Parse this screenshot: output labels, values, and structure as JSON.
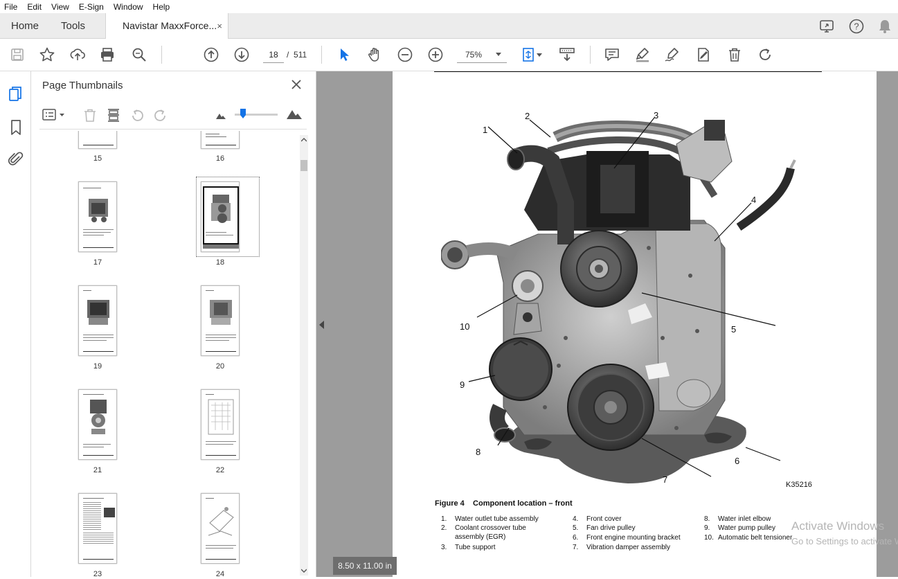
{
  "menu": [
    "File",
    "Edit",
    "View",
    "E-Sign",
    "Window",
    "Help"
  ],
  "tabs": {
    "home": "Home",
    "tools": "Tools",
    "document": "Navistar MaxxForce...",
    "close": "×"
  },
  "toolbar": {
    "current_page": "18",
    "page_sep": "/",
    "total_pages": "511",
    "zoom": "75%"
  },
  "thumbnails": {
    "title": "Page Thumbnails",
    "selected_page": "18",
    "pages": [
      "15",
      "16",
      "17",
      "18",
      "19",
      "20",
      "21",
      "22",
      "23",
      "24"
    ]
  },
  "document": {
    "page_size": "8.50 x 11.00 in",
    "figure_id": "K35216",
    "figure_number": "Figure 4",
    "figure_caption": "Component location – front",
    "callouts": [
      "1",
      "2",
      "3",
      "4",
      "5",
      "6",
      "7",
      "8",
      "9",
      "10"
    ],
    "legend": [
      {
        "n": "1.",
        "text": "Water outlet tube assembly"
      },
      {
        "n": "2.",
        "text": "Coolant crossover tube"
      },
      {
        "n": "",
        "text": "assembly (EGR)"
      },
      {
        "n": "3.",
        "text": "Tube support"
      },
      {
        "n": "4.",
        "text": "Front cover"
      },
      {
        "n": "5.",
        "text": "Fan drive pulley"
      },
      {
        "n": "6.",
        "text": "Front engine mounting bracket"
      },
      {
        "n": "7.",
        "text": "Vibration damper assembly"
      },
      {
        "n": "8.",
        "text": "Water inlet elbow"
      },
      {
        "n": "9.",
        "text": "Water pump pulley"
      },
      {
        "n": "10.",
        "text": "Automatic belt tensioner"
      }
    ]
  },
  "watermark": {
    "line1": "Activate Windows",
    "line2": "Go to Settings to activate Windows."
  },
  "icons": {
    "save": "save-icon",
    "bookmark_star": "star-icon",
    "upload": "upload-icon",
    "print": "print-icon",
    "find": "search-icon",
    "prev": "arrow-up-icon",
    "next": "arrow-down-icon",
    "select": "cursor-icon",
    "hand": "hand-icon",
    "zoom_out": "zoom-out-icon",
    "zoom_in": "zoom-in-icon"
  },
  "colors": {
    "accent": "#1473e6",
    "doc_bg": "#9c9c9c",
    "tabbar": "#ececec"
  }
}
